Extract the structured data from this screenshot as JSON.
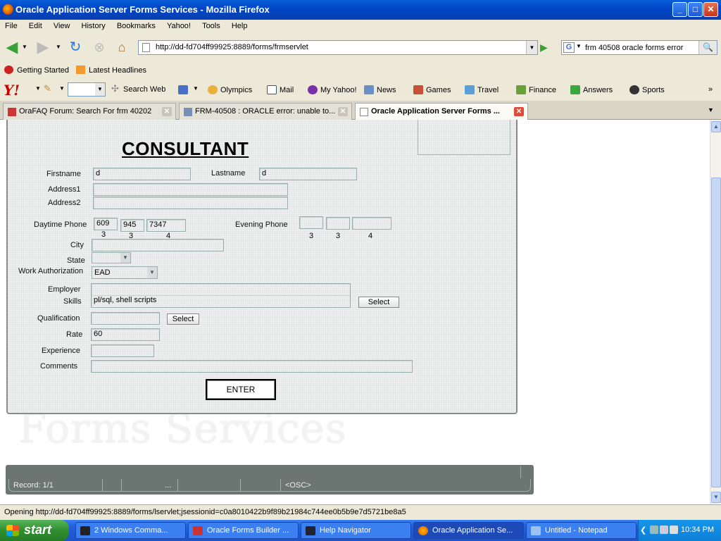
{
  "window": {
    "title": "Oracle Application Server Forms Services - Mozilla Firefox",
    "controls": {
      "minimize": "_",
      "maximize": "□",
      "close": "✕"
    }
  },
  "menu": [
    "File",
    "Edit",
    "View",
    "History",
    "Bookmarks",
    "Yahoo!",
    "Tools",
    "Help"
  ],
  "nav": {
    "url": "http://dd-fd704ff99925:8889/forms/frmservlet",
    "search_value": "frm 40508 oracle forms error",
    "search_engine_letter": "G"
  },
  "bookmarks": [
    "Getting Started",
    "Latest Headlines"
  ],
  "yahoo_toolbar": {
    "logo": "Y!",
    "items": [
      "Search Web",
      "Olympics",
      "Mail",
      "My Yahoo!",
      "News",
      "Games",
      "Travel",
      "Finance",
      "Answers",
      "Sports"
    ]
  },
  "tabs": [
    {
      "label": "OraFAQ Forum: Search For frm 40202",
      "active": false
    },
    {
      "label": "FRM-40508 : ORACLE error: unable to...",
      "active": false
    },
    {
      "label": "Oracle Application Server Forms ...",
      "active": true
    }
  ],
  "form": {
    "heading": "CONSULTANT",
    "labels": {
      "firstname": "Firstname",
      "lastname": "Lastname",
      "address1": "Address1",
      "address2": "Address2",
      "daytime_phone": "Daytime Phone",
      "evening_phone": "Evening Phone",
      "city": "City",
      "state": "State",
      "work_authorization": "Work Authorization",
      "employer": "Employer",
      "skills": "Skills",
      "qualification": "Qualification",
      "rate": "Rate",
      "experience": "Experience",
      "comments": "Comments"
    },
    "values": {
      "firstname": "d",
      "lastname": "d",
      "address1": "",
      "address2": "",
      "day_area": "609",
      "day_prefix": "945",
      "day_line": "7347",
      "eve_area": "",
      "eve_prefix": "",
      "eve_line": "",
      "city": "",
      "state": "",
      "work_authorization": "EAD",
      "employer": "",
      "skills": "pl/sql, shell scripts",
      "qualification": "",
      "rate": "60",
      "experience": "",
      "comments": ""
    },
    "phone_hints": [
      "3",
      "3",
      "4"
    ],
    "select_label": "Select",
    "enter_label": "ENTER"
  },
  "watermark": "Forms Services",
  "record_bar": {
    "record": "Record: 1/1",
    "ellipsis": "...",
    "mode": "<OSC>"
  },
  "status": "Opening http://dd-fd704ff99925:8889/forms/lservlet;jsessionid=c0a8010422b9f89b21984c744ee0b5b9e7d5721be8a5",
  "taskbar": {
    "start": "start",
    "tasks": [
      {
        "label": "2 Windows Comma...",
        "active": false
      },
      {
        "label": "Oracle Forms Builder ...",
        "active": false
      },
      {
        "label": "Help Navigator",
        "active": false
      },
      {
        "label": "Oracle Application Se...",
        "active": true
      },
      {
        "label": "Untitled - Notepad",
        "active": false
      }
    ],
    "clock": "10:34 PM"
  }
}
